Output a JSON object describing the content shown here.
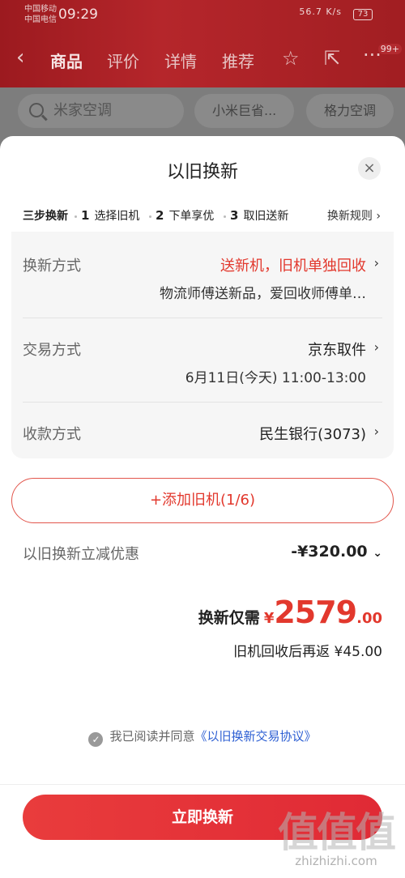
{
  "status": {
    "carrier1": "中国移动",
    "carrier2": "中国电信",
    "time": "09:29",
    "net_speed": "56.7 K/s",
    "battery": "73"
  },
  "nav": {
    "tabs": [
      "商品",
      "评价",
      "详情",
      "推荐"
    ],
    "badge": "99+"
  },
  "search": {
    "placeholder": "米家空调",
    "chips": [
      "小米巨省...",
      "格力空调"
    ]
  },
  "sheet": {
    "title": "以旧换新",
    "close_glyph": "×",
    "steps_label": "三步换新",
    "steps": [
      {
        "num": "1",
        "label": "选择旧机"
      },
      {
        "num": "2",
        "label": "下单享优"
      },
      {
        "num": "3",
        "label": "取旧送新"
      }
    ],
    "rules": "换新规则 ›",
    "rows": {
      "method": {
        "label": "换新方式",
        "value": "送新机，旧机单独回收",
        "sub": "物流师傅送新品，爱回收师傅单…"
      },
      "trade": {
        "label": "交易方式",
        "value": "京东取件",
        "sub": "6月11日(今天) 11:00-13:00"
      },
      "payment": {
        "label": "收款方式",
        "value": "民生银行(3073)"
      }
    },
    "add_button": "+添加旧机(1/6)",
    "discount": {
      "label": "以旧换新立减优惠",
      "value": "-¥320.00"
    },
    "total": {
      "label": "换新仅需",
      "currency": "¥",
      "int": "2579",
      "dec": ".00"
    },
    "rebate": "旧机回收后再返 ¥45.00",
    "agree": {
      "text": "我已阅读并同意",
      "link": "《以旧换新交易协议》"
    },
    "cta": "立即换新"
  },
  "watermark": {
    "big": "值值值",
    "small": "zhizhizhi.com"
  },
  "colors": {
    "accent": "#e2382d",
    "link": "#2d5fd3",
    "header": "#a11e22"
  }
}
